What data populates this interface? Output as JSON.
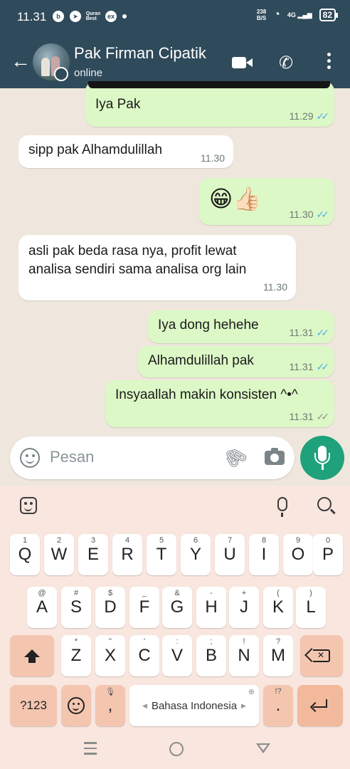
{
  "status_bar": {
    "time": "11.31",
    "icons": [
      "b-icon",
      "telegram-icon",
      "quran-app-icon",
      "ex-icon",
      "dot-icon"
    ],
    "net_speed_value": "238",
    "net_speed_unit": "B/S",
    "signal_label": "4G",
    "battery": "82"
  },
  "header": {
    "contact_name": "Pak Firman Cipatik",
    "status": "online"
  },
  "messages": [
    {
      "direction": "out",
      "text": "Iya Pak",
      "time": "11.29",
      "ticks": "read"
    },
    {
      "direction": "in",
      "text": "sipp pak Alhamdulillah",
      "time": "11.30"
    },
    {
      "direction": "out",
      "text": "😁👍🏻",
      "time": "11.30",
      "ticks": "read"
    },
    {
      "direction": "in",
      "text": "asli pak beda rasa nya, profit lewat analisa sendiri sama analisa org lain",
      "time": "11.30"
    },
    {
      "direction": "out",
      "text": "Iya dong hehehe",
      "time": "11.31",
      "ticks": "read"
    },
    {
      "direction": "out",
      "text": "Alhamdulillah pak",
      "time": "11.31",
      "ticks": "read"
    },
    {
      "direction": "out",
      "text": "Insyaallah makin konsisten ^•^",
      "time": "11.31",
      "ticks": "delivered"
    }
  ],
  "composer": {
    "placeholder": "Pesan"
  },
  "keyboard": {
    "row1": [
      {
        "key": "Q",
        "hint": "1"
      },
      {
        "key": "W",
        "hint": "2"
      },
      {
        "key": "E",
        "hint": "3"
      },
      {
        "key": "R",
        "hint": "4"
      },
      {
        "key": "T",
        "hint": "5"
      },
      {
        "key": "Y",
        "hint": "6"
      },
      {
        "key": "U",
        "hint": "7"
      },
      {
        "key": "I",
        "hint": "8"
      },
      {
        "key": "O",
        "hint": "9"
      },
      {
        "key": "P",
        "hint": "0"
      }
    ],
    "row2": [
      {
        "key": "A",
        "hint": "@"
      },
      {
        "key": "S",
        "hint": "#"
      },
      {
        "key": "D",
        "hint": "$"
      },
      {
        "key": "F",
        "hint": "_"
      },
      {
        "key": "G",
        "hint": "&"
      },
      {
        "key": "H",
        "hint": "-"
      },
      {
        "key": "J",
        "hint": "+"
      },
      {
        "key": "K",
        "hint": "("
      },
      {
        "key": "L",
        "hint": ")"
      }
    ],
    "row3": [
      {
        "key": "Z",
        "hint": "*"
      },
      {
        "key": "X",
        "hint": "\""
      },
      {
        "key": "C",
        "hint": "'"
      },
      {
        "key": "V",
        "hint": ":"
      },
      {
        "key": "B",
        "hint": ";"
      },
      {
        "key": "N",
        "hint": "!"
      },
      {
        "key": "M",
        "hint": "?"
      }
    ],
    "symbols_key": "?123",
    "comma_key": ",",
    "space_label": "Bahasa Indonesia",
    "period_key": ".",
    "period_hint": "!?"
  },
  "colors": {
    "header_bg": "#2f4a5a",
    "outgoing_bubble": "#dcf8c6",
    "incoming_bubble": "#ffffff",
    "read_ticks": "#4fb1e8",
    "mic_button": "#1fa17b",
    "keyboard_bg": "#f8e6df"
  }
}
